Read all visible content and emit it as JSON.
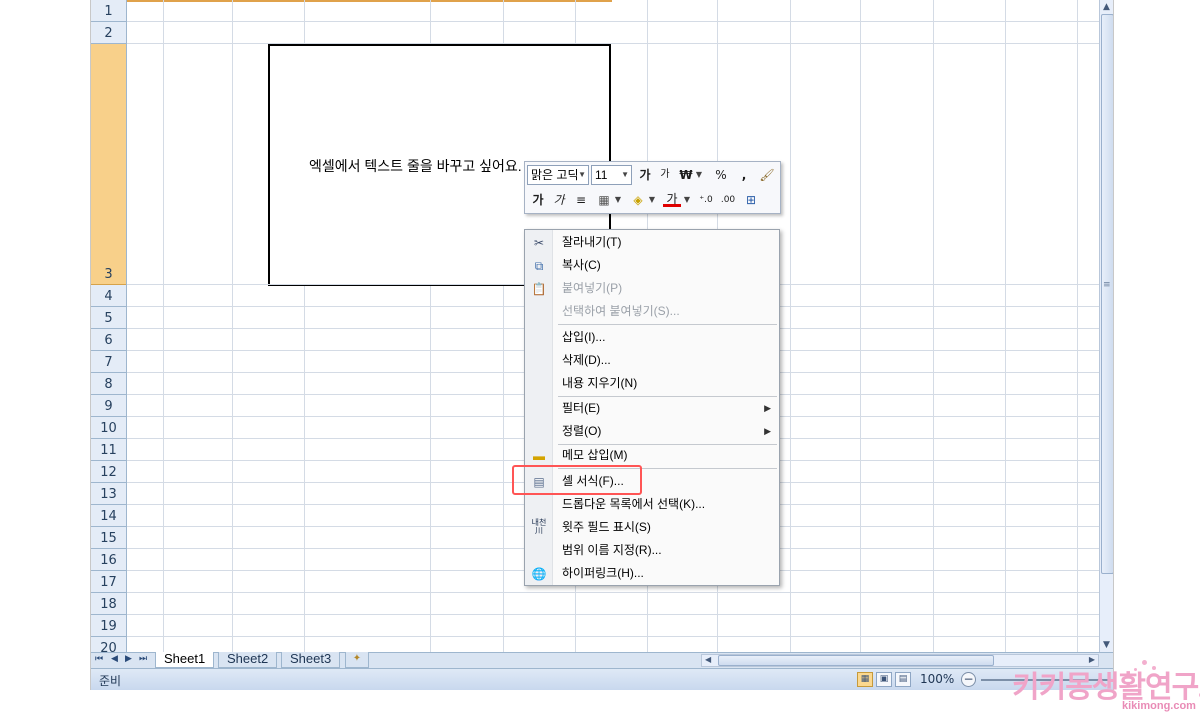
{
  "rows": [
    "1",
    "2",
    "3",
    "4",
    "5",
    "6",
    "7",
    "8",
    "9",
    "10",
    "11",
    "12",
    "13",
    "14",
    "15",
    "16",
    "17",
    "18",
    "19",
    "20"
  ],
  "selected_row": "3",
  "cell_text": "엑셀에서 텍스트 줄을 바꾸고 싶어요.",
  "mini_toolbar": {
    "font_name": "맑은 고딕",
    "font_size": "11",
    "grow_font": "가",
    "shrink_font": "가",
    "currency": "₩",
    "percent": "%",
    "comma": ",",
    "bold": "가",
    "italic": "가",
    "font_color": "가"
  },
  "context_menu": {
    "items": [
      {
        "label": "잘라내기(T)",
        "enabled": true,
        "icon": "scissors-icon"
      },
      {
        "label": "복사(C)",
        "enabled": true,
        "icon": "copy-icon"
      },
      {
        "label": "붙여넣기(P)",
        "enabled": false,
        "icon": "paste-icon"
      },
      {
        "label": "선택하여 붙여넣기(S)...",
        "enabled": false
      },
      {
        "label": "삽입(I)...",
        "enabled": true
      },
      {
        "label": "삭제(D)...",
        "enabled": true
      },
      {
        "label": "내용 지우기(N)",
        "enabled": true
      },
      {
        "label": "필터(E)",
        "enabled": true,
        "submenu": true
      },
      {
        "label": "정렬(O)",
        "enabled": true,
        "submenu": true
      },
      {
        "label": "메모 삽입(M)",
        "enabled": true,
        "icon": "insert-comment-icon"
      },
      {
        "label": "셀 서식(F)...",
        "enabled": true,
        "icon": "format-cells-icon",
        "highlighted": true
      },
      {
        "label": "드롭다운 목록에서 선택(K)...",
        "enabled": true
      },
      {
        "label": "윗주 필드 표시(S)",
        "enabled": true,
        "icon": "phonetic-guide-icon",
        "icon_text": "내천\n川"
      },
      {
        "label": "범위 이름 지정(R)...",
        "enabled": true
      },
      {
        "label": "하이퍼링크(H)...",
        "enabled": true,
        "icon": "hyperlink-icon"
      }
    ]
  },
  "sheet_tabs": [
    "Sheet1",
    "Sheet2",
    "Sheet3"
  ],
  "active_sheet": "Sheet1",
  "status": {
    "ready_text": "준비",
    "zoom": "100%"
  },
  "watermark": {
    "title": "키키몽생활연구소",
    "url": "kikimong.com"
  },
  "colors": {
    "selected_row_header": "#f8d08a",
    "highlight_box": "#ff5555",
    "watermark_pink": "#f0a4c8"
  }
}
